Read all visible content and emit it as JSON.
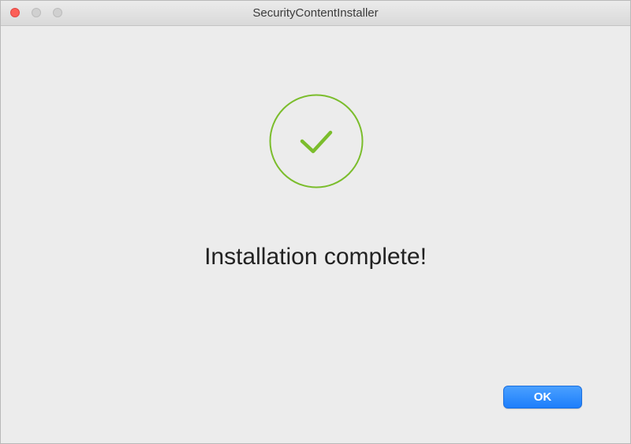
{
  "window": {
    "title": "SecurityContentInstaller"
  },
  "status": {
    "icon": "checkmark-circle-icon",
    "message": "Installation complete!",
    "accent_color": "#7bbd2c"
  },
  "actions": {
    "ok_label": "OK",
    "ok_color": "#1d7efb"
  }
}
